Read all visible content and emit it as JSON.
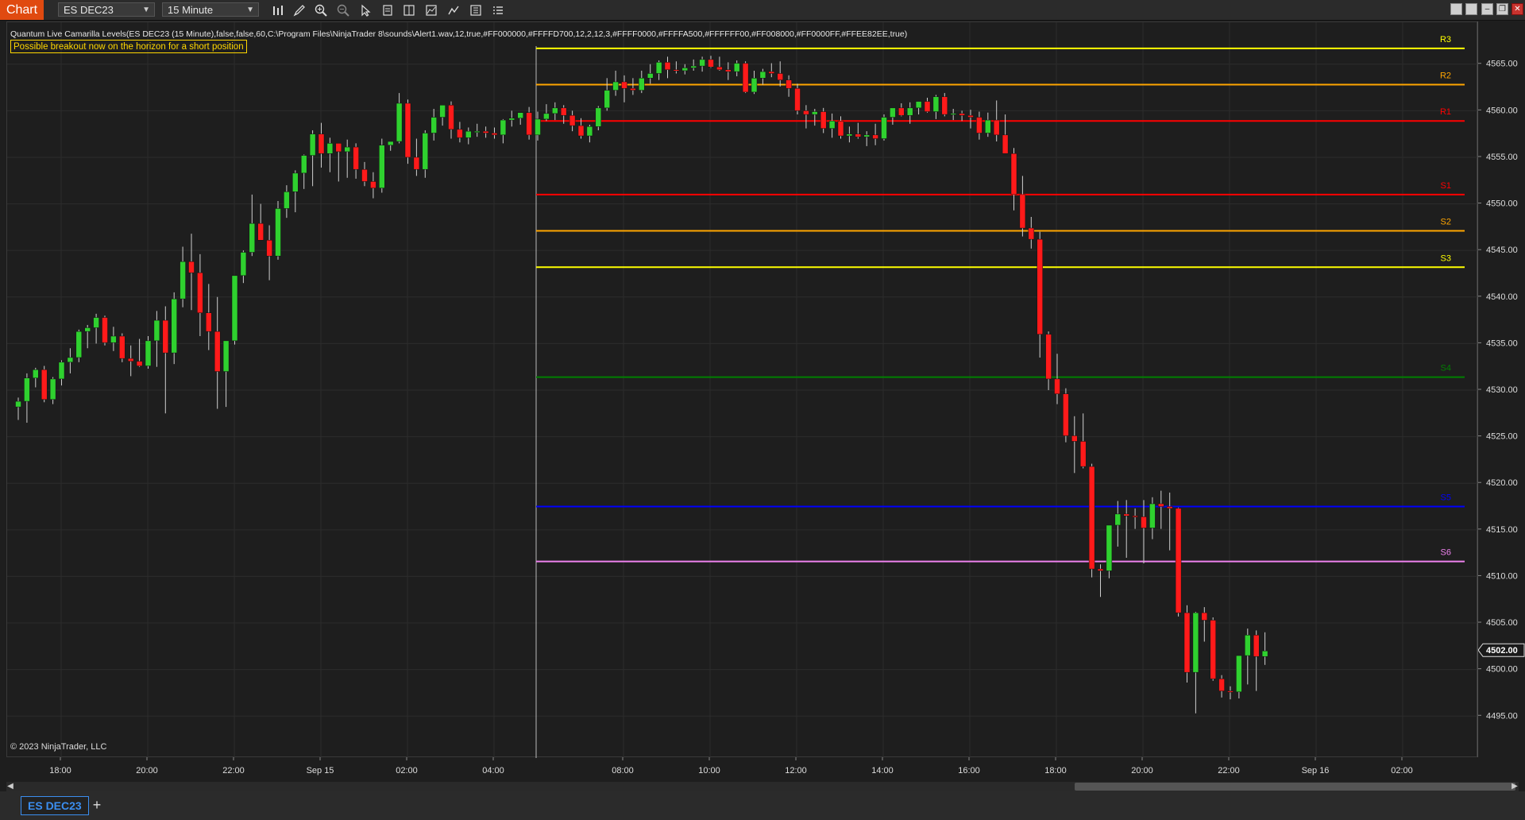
{
  "app": {
    "label": "Chart"
  },
  "toolbar": {
    "instrument": "ES DEC23",
    "interval": "15 Minute",
    "icons": [
      "bar-style-icon",
      "pencil-icon",
      "zoom-in-icon",
      "zoom-out-icon",
      "pointer-icon",
      "properties-icon",
      "data-box-icon",
      "indicators-icon",
      "strategies-icon",
      "list-icon"
    ]
  },
  "window_controls": [
    "minimize-icon",
    "restore-icon",
    "maximize-icon",
    "close-icon"
  ],
  "indicator": {
    "label": "Quantum Live Camarilla Levels(ES DEC23 (15 Minute),false,false,60,C:\\Program Files\\NinjaTrader 8\\sounds\\Alert1.wav,12,true,#FF000000,#FFFFD700,12,2,12,3,#FFFF0000,#FFFFA500,#FFFFFF00,#FF008000,#FF0000FF,#FFEE82EE,true)",
    "alert_text": "Possible breakout now on the horizon for a short position"
  },
  "copyright": "© 2023 NinjaTrader, LLC",
  "current_price": "4502.00",
  "tab": {
    "label": "ES DEC23",
    "add": "+"
  },
  "chart_data": {
    "type": "candlestick",
    "colors": {
      "up": "#2fd12f",
      "down": "#ff1a1a",
      "grid": "#2c2c2c",
      "background": "#1e1e1e"
    },
    "ylim": [
      4490.5,
      4569.5
    ],
    "y_ticks": [
      "4565.00",
      "4560.00",
      "4555.00",
      "4550.00",
      "4545.00",
      "4540.00",
      "4535.00",
      "4530.00",
      "4525.00",
      "4520.00",
      "4515.00",
      "4510.00",
      "4505.00",
      "4500.00",
      "4495.00"
    ],
    "x_ticks": [
      "18:00",
      "20:00",
      "22:00",
      "Sep 15",
      "02:00",
      "04:00",
      "08:00",
      "10:00",
      "12:00",
      "14:00",
      "16:00",
      "18:00",
      "20:00",
      "22:00",
      "Sep 16",
      "02:00"
    ],
    "session_separator": "05:00",
    "levels": [
      {
        "name": "R3",
        "value": 4566.7,
        "color": "#ffff00"
      },
      {
        "name": "R2",
        "value": 4562.8,
        "color": "#ffa500"
      },
      {
        "name": "R1",
        "value": 4558.9,
        "color": "#ff0000"
      },
      {
        "name": "S1",
        "value": 4551.0,
        "color": "#ff0000"
      },
      {
        "name": "S2",
        "value": 4547.1,
        "color": "#ffa500"
      },
      {
        "name": "S3",
        "value": 4543.2,
        "color": "#ffff00"
      },
      {
        "name": "S4",
        "value": 4531.4,
        "color": "#008000"
      },
      {
        "name": "S5",
        "value": 4517.5,
        "color": "#0000ff"
      },
      {
        "name": "S6",
        "value": 4511.6,
        "color": "#ee82ee"
      }
    ],
    "candles": [
      [
        4528.2,
        4529.2,
        4526.8,
        4528.8
      ],
      [
        4528.8,
        4531.8,
        4526.5,
        4531.3
      ],
      [
        4531.3,
        4532.4,
        4530.3,
        4532.2
      ],
      [
        4532.2,
        4532.6,
        4528.7,
        4529.0
      ],
      [
        4529.0,
        4531.4,
        4528.5,
        4531.2
      ],
      [
        4531.2,
        4533.2,
        4530.5,
        4533.0
      ],
      [
        4533.0,
        4534.5,
        4531.8,
        4533.5
      ],
      [
        4533.5,
        4536.5,
        4533.0,
        4536.3
      ],
      [
        4536.3,
        4537.0,
        4534.5,
        4536.7
      ],
      [
        4536.7,
        4538.2,
        4535.0,
        4537.8
      ],
      [
        4537.8,
        4538.0,
        4534.8,
        4535.1
      ],
      [
        4535.1,
        4536.8,
        4534.2,
        4535.8
      ],
      [
        4535.8,
        4536.1,
        4533.0,
        4533.4
      ],
      [
        4533.4,
        4534.8,
        4531.5,
        4533.1
      ],
      [
        4533.1,
        4535.5,
        4532.5,
        4532.6
      ],
      [
        4532.6,
        4535.8,
        4532.3,
        4535.3
      ],
      [
        4535.3,
        4538.5,
        4532.5,
        4537.5
      ],
      [
        4537.5,
        4539.0,
        4527.5,
        4534.0
      ],
      [
        4534.0,
        4540.5,
        4532.8,
        4539.8
      ],
      [
        4539.8,
        4545.4,
        4538.9,
        4543.8
      ],
      [
        4543.8,
        4546.8,
        4538.6,
        4542.6
      ],
      [
        4542.6,
        4544.6,
        4535.8,
        4538.3
      ],
      [
        4538.3,
        4541.4,
        4534.3,
        4536.3
      ],
      [
        4536.3,
        4540.0,
        4528.0,
        4532.0
      ],
      [
        4532.0,
        4534.8,
        4528.2,
        4535.3
      ],
      [
        4535.3,
        4542.1,
        4534.9,
        4542.3
      ],
      [
        4542.3,
        4545.0,
        4541.5,
        4544.8
      ],
      [
        4544.8,
        4551.0,
        4544.4,
        4547.9
      ],
      [
        4547.9,
        4550.0,
        4546.2,
        4546.1
      ],
      [
        4546.1,
        4547.7,
        4541.8,
        4544.4
      ],
      [
        4544.4,
        4550.3,
        4544.0,
        4549.5
      ],
      [
        4549.5,
        4552.0,
        4548.5,
        4551.3
      ],
      [
        4551.3,
        4553.6,
        4549.1,
        4553.3
      ],
      [
        4553.3,
        4555.3,
        4551.6,
        4555.2
      ],
      [
        4555.2,
        4557.9,
        4551.9,
        4557.5
      ],
      [
        4557.5,
        4558.7,
        4553.9,
        4555.4
      ],
      [
        4555.4,
        4557.1,
        4553.4,
        4556.5
      ],
      [
        4556.5,
        4556.5,
        4552.4,
        4555.6
      ],
      [
        4555.6,
        4556.9,
        4552.8,
        4556.1
      ],
      [
        4556.1,
        4556.5,
        4552.7,
        4553.7
      ],
      [
        4553.7,
        4554.5,
        4551.9,
        4552.4
      ],
      [
        4552.4,
        4553.4,
        4550.6,
        4551.7
      ],
      [
        4551.7,
        4557.0,
        4551.2,
        4556.3
      ],
      [
        4556.3,
        4556.5,
        4555.7,
        4556.7
      ],
      [
        4556.7,
        4561.9,
        4556.5,
        4560.8
      ],
      [
        4560.8,
        4561.2,
        4554.3,
        4555.0
      ],
      [
        4555.0,
        4557.0,
        4553.0,
        4553.7
      ],
      [
        4553.7,
        4557.9,
        4552.8,
        4557.6
      ],
      [
        4557.6,
        4560.2,
        4556.8,
        4559.3
      ],
      [
        4559.3,
        4560.5,
        4558.4,
        4560.6
      ],
      [
        4560.6,
        4561.0,
        4557.0,
        4558.0
      ],
      [
        4558.0,
        4558.8,
        4556.6,
        4557.1
      ],
      [
        4557.1,
        4558.2,
        4556.4,
        4557.8
      ],
      [
        4557.8,
        4558.6,
        4557.2,
        4557.8
      ],
      [
        4557.8,
        4558.3,
        4557.1,
        4557.6
      ],
      [
        4557.6,
        4558.2,
        4557.0,
        4557.4
      ],
      [
        4557.4,
        4559.1,
        4556.5,
        4559.0
      ],
      [
        4559.0,
        4560.0,
        4558.3,
        4559.2
      ],
      [
        4559.2,
        4559.5,
        4558.5,
        4559.8
      ],
      [
        4559.8,
        4560.4,
        4556.9,
        4557.4
      ],
      [
        4557.4,
        4559.9,
        4556.8,
        4559.1
      ],
      [
        4559.1,
        4560.7,
        4558.9,
        4559.7
      ],
      [
        4559.7,
        4560.9,
        4559.0,
        4560.3
      ],
      [
        4560.3,
        4560.6,
        4558.6,
        4559.5
      ],
      [
        4559.5,
        4560.0,
        4557.8,
        4558.4
      ],
      [
        4558.4,
        4559.2,
        4557.0,
        4557.3
      ],
      [
        4557.3,
        4558.5,
        4556.6,
        4558.3
      ],
      [
        4558.3,
        4560.5,
        4557.9,
        4560.3
      ],
      [
        4560.3,
        4563.5,
        4560.0,
        4562.2
      ],
      [
        4562.2,
        4564.3,
        4561.6,
        4563.1
      ],
      [
        4563.1,
        4563.8,
        4560.9,
        4562.4
      ],
      [
        4562.4,
        4563.5,
        4561.7,
        4562.2
      ],
      [
        4562.2,
        4564.3,
        4561.9,
        4563.5
      ],
      [
        4563.5,
        4565.0,
        4562.9,
        4564.0
      ],
      [
        4564.0,
        4565.4,
        4563.3,
        4565.2
      ],
      [
        4565.2,
        4565.8,
        4563.5,
        4564.4
      ],
      [
        4564.4,
        4565.3,
        4564.0,
        4564.3
      ],
      [
        4564.3,
        4565.0,
        4563.9,
        4564.6
      ],
      [
        4564.6,
        4565.5,
        4564.3,
        4564.8
      ],
      [
        4564.8,
        4565.8,
        4564.2,
        4565.5
      ],
      [
        4565.5,
        4565.9,
        4564.6,
        4564.7
      ],
      [
        4564.7,
        4565.8,
        4564.3,
        4564.4
      ],
      [
        4564.4,
        4565.2,
        4563.3,
        4564.2
      ],
      [
        4564.2,
        4565.4,
        4563.7,
        4565.1
      ],
      [
        4565.1,
        4565.3,
        4561.9,
        4562.0
      ],
      [
        4562.0,
        4564.3,
        4561.8,
        4563.5
      ],
      [
        4563.5,
        4564.5,
        4562.8,
        4564.2
      ],
      [
        4564.2,
        4565.1,
        4563.6,
        4564.0
      ],
      [
        4564.0,
        4565.3,
        4562.6,
        4563.3
      ],
      [
        4563.3,
        4563.8,
        4561.5,
        4562.4
      ],
      [
        4562.4,
        4562.9,
        4559.6,
        4560.0
      ],
      [
        4560.0,
        4560.6,
        4558.1,
        4559.6
      ],
      [
        4559.6,
        4560.2,
        4558.4,
        4559.9
      ],
      [
        4559.9,
        4560.3,
        4557.6,
        4558.1
      ],
      [
        4558.1,
        4559.7,
        4557.1,
        4558.9
      ],
      [
        4558.9,
        4559.4,
        4557.0,
        4557.3
      ],
      [
        4557.3,
        4558.3,
        4556.6,
        4557.5
      ],
      [
        4557.5,
        4558.7,
        4557.0,
        4557.2
      ],
      [
        4557.2,
        4557.8,
        4556.2,
        4557.4
      ],
      [
        4557.4,
        4558.6,
        4556.3,
        4557.0
      ],
      [
        4557.0,
        4559.6,
        4556.8,
        4559.3
      ],
      [
        4559.3,
        4560.1,
        4558.5,
        4560.3
      ],
      [
        4560.3,
        4560.8,
        4559.4,
        4559.5
      ],
      [
        4559.5,
        4560.9,
        4558.6,
        4560.3
      ],
      [
        4560.3,
        4560.8,
        4559.6,
        4561.0
      ],
      [
        4561.0,
        4561.4,
        4559.8,
        4559.9
      ],
      [
        4559.9,
        4561.7,
        4559.1,
        4561.5
      ],
      [
        4561.5,
        4561.9,
        4559.4,
        4559.6
      ],
      [
        4559.6,
        4560.2,
        4559.0,
        4559.7
      ],
      [
        4559.7,
        4560.0,
        4558.9,
        4559.5
      ],
      [
        4559.5,
        4560.1,
        4558.1,
        4559.3
      ],
      [
        4559.3,
        4559.9,
        4556.9,
        4557.6
      ],
      [
        4557.6,
        4559.8,
        4557.2,
        4559.0
      ],
      [
        4559.0,
        4561.1,
        4556.7,
        4557.4
      ],
      [
        4557.4,
        4559.6,
        4555.7,
        4555.4
      ],
      [
        4555.4,
        4556.0,
        4549.3,
        4551.0
      ],
      [
        4551.0,
        4553.0,
        4546.5,
        4547.4
      ],
      [
        4547.4,
        4548.6,
        4545.2,
        4546.2
      ],
      [
        4546.2,
        4547.0,
        4533.5,
        4536.0
      ],
      [
        4536.0,
        4536.3,
        4530.0,
        4531.2
      ],
      [
        4531.2,
        4533.9,
        4528.5,
        4529.6
      ],
      [
        4529.6,
        4530.2,
        4524.4,
        4525.1
      ],
      [
        4525.1,
        4527.2,
        4521.1,
        4524.5
      ],
      [
        4524.5,
        4527.5,
        4521.6,
        4521.8
      ],
      [
        4521.8,
        4522.1,
        4509.9,
        4510.8
      ],
      [
        4510.8,
        4511.3,
        4507.8,
        4510.6
      ],
      [
        4510.6,
        4515.4,
        4509.8,
        4515.5
      ],
      [
        4515.5,
        4518.1,
        4513.2,
        4516.7
      ],
      [
        4516.7,
        4518.2,
        4512.0,
        4516.5
      ],
      [
        4516.5,
        4517.3,
        4515.1,
        4516.4
      ],
      [
        4516.4,
        4518.2,
        4511.4,
        4515.2
      ],
      [
        4515.2,
        4518.5,
        4514.0,
        4517.8
      ],
      [
        4517.8,
        4519.2,
        4515.1,
        4517.5
      ],
      [
        4517.5,
        4519.0,
        4512.8,
        4517.3
      ],
      [
        4517.3,
        4517.4,
        4505.7,
        4506.1
      ],
      [
        4506.1,
        4506.9,
        4498.6,
        4499.7
      ],
      [
        4499.7,
        4506.2,
        4495.3,
        4506.1
      ],
      [
        4506.1,
        4506.7,
        4503.0,
        4505.3
      ],
      [
        4505.3,
        4505.6,
        4498.8,
        4499.0
      ],
      [
        4499.0,
        4499.4,
        4497.0,
        4497.7
      ],
      [
        4497.7,
        4498.2,
        4496.8,
        4497.6
      ],
      [
        4497.6,
        4501.5,
        4496.9,
        4501.5
      ],
      [
        4501.5,
        4504.4,
        4498.4,
        4503.7
      ],
      [
        4503.7,
        4504.2,
        4497.7,
        4501.4
      ],
      [
        4501.4,
        4504.0,
        4500.5,
        4502.0
      ]
    ]
  }
}
